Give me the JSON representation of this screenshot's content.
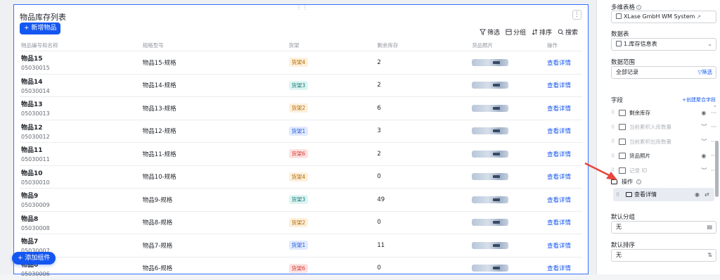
{
  "list": {
    "title": "物品库存列表",
    "add_button": "+ 新增物品",
    "toolbar": {
      "filter": "筛选",
      "group": "分组",
      "sort": "排序",
      "search": "搜索"
    },
    "columns": [
      "物品编号和名称",
      "规格型号",
      "货架",
      "剩余库存",
      "货品照片",
      "操作"
    ],
    "rows": [
      {
        "name": "物品15",
        "code": "05030015",
        "spec": "物品15-规格",
        "shelf": "货架4",
        "stock": "2",
        "action": "查看详情"
      },
      {
        "name": "物品14",
        "code": "05030014",
        "spec": "物品14-规格",
        "shelf": "货架3",
        "stock": "2",
        "action": "查看详情"
      },
      {
        "name": "物品13",
        "code": "05030013",
        "spec": "物品13-规格",
        "shelf": "货架2",
        "stock": "6",
        "action": "查看详情"
      },
      {
        "name": "物品12",
        "code": "05030012",
        "spec": "物品12-规格",
        "shelf": "货架1",
        "stock": "3",
        "action": "查看详情"
      },
      {
        "name": "物品11",
        "code": "05030011",
        "spec": "物品11-规格",
        "shelf": "货架6",
        "stock": "2",
        "action": "查看详情"
      },
      {
        "name": "物品10",
        "code": "05030010",
        "spec": "物品10-规格",
        "shelf": "货架4",
        "stock": "0",
        "action": "查看详情"
      },
      {
        "name": "物品9",
        "code": "05030009",
        "spec": "物品9-规格",
        "shelf": "货架3",
        "stock": "49",
        "action": "查看详情"
      },
      {
        "name": "物品8",
        "code": "05030008",
        "spec": "物品8-规格",
        "shelf": "货架2",
        "stock": "0",
        "action": "查看详情"
      },
      {
        "name": "物品7",
        "code": "05030007",
        "spec": "物品7-规格",
        "shelf": "货架1",
        "stock": "11",
        "action": "查看详情"
      },
      {
        "name": "物品6",
        "code": "05030006",
        "spec": "物品6-规格",
        "shelf": "货架6",
        "stock": "0",
        "action": "查看详情"
      }
    ],
    "add_component": "+ 添加组件"
  },
  "shelf_colors": {
    "货架1": {
      "bg": "#e1eaff",
      "fg": "#245bdb"
    },
    "货架2": {
      "bg": "#fdf0dc",
      "fg": "#b26a00"
    },
    "货架3": {
      "bg": "#dff5f3",
      "fg": "#0e7a75"
    },
    "货架4": {
      "bg": "#fdf0dc",
      "fg": "#b26a00"
    },
    "货架6": {
      "bg": "#fde2e2",
      "fg": "#d83931"
    }
  },
  "panel": {
    "multi_table_label": "多维表格",
    "multi_table_value": "XLase GmbH WM System",
    "data_table_label": "数据表",
    "data_table_value": "1.库存信息表",
    "data_range_label": "数据范围",
    "data_range_value": "全部记录",
    "data_range_filter": "筛选",
    "fields_label": "字段",
    "add_field": "+创建聚合字段",
    "fields": [
      {
        "name": "剩余库存",
        "disabled": false
      },
      {
        "name": "当前累积入库数量",
        "disabled": true
      },
      {
        "name": "当前累积出库数量",
        "disabled": true
      },
      {
        "name": "货品照片",
        "disabled": false
      },
      {
        "name": "记录 ID",
        "disabled": true
      }
    ],
    "operation_label": "操作",
    "operation_item": "查看详情",
    "default_group_label": "默认分组",
    "default_group_value": "无",
    "default_sort_label": "默认排序",
    "default_sort_value": "无"
  },
  "colors": {
    "accent": "#1456f0",
    "arrow": "#e8453c"
  }
}
